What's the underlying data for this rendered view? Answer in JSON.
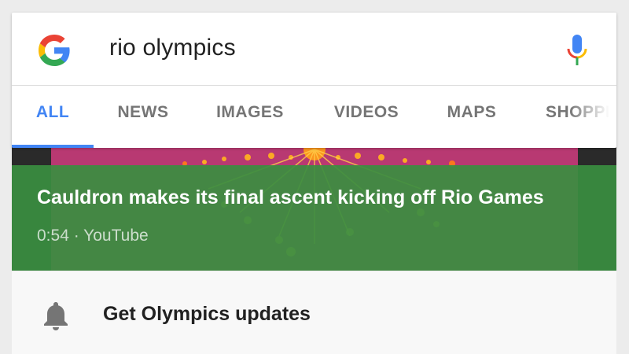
{
  "search": {
    "query": "rio olympics"
  },
  "tabs": [
    {
      "label": "ALL",
      "active": true
    },
    {
      "label": "NEWS"
    },
    {
      "label": "IMAGES"
    },
    {
      "label": "VIDEOS"
    },
    {
      "label": "MAPS"
    },
    {
      "label": "SHOPPI"
    }
  ],
  "video": {
    "title": "Cauldron makes its final ascent kicking off Rio Games",
    "meta": "0:54 · YouTube"
  },
  "updates": {
    "label": "Get Olympics updates",
    "icon": "bell-icon"
  },
  "colors": {
    "accent": "#4285f4",
    "overlay_green": "#398e40"
  }
}
